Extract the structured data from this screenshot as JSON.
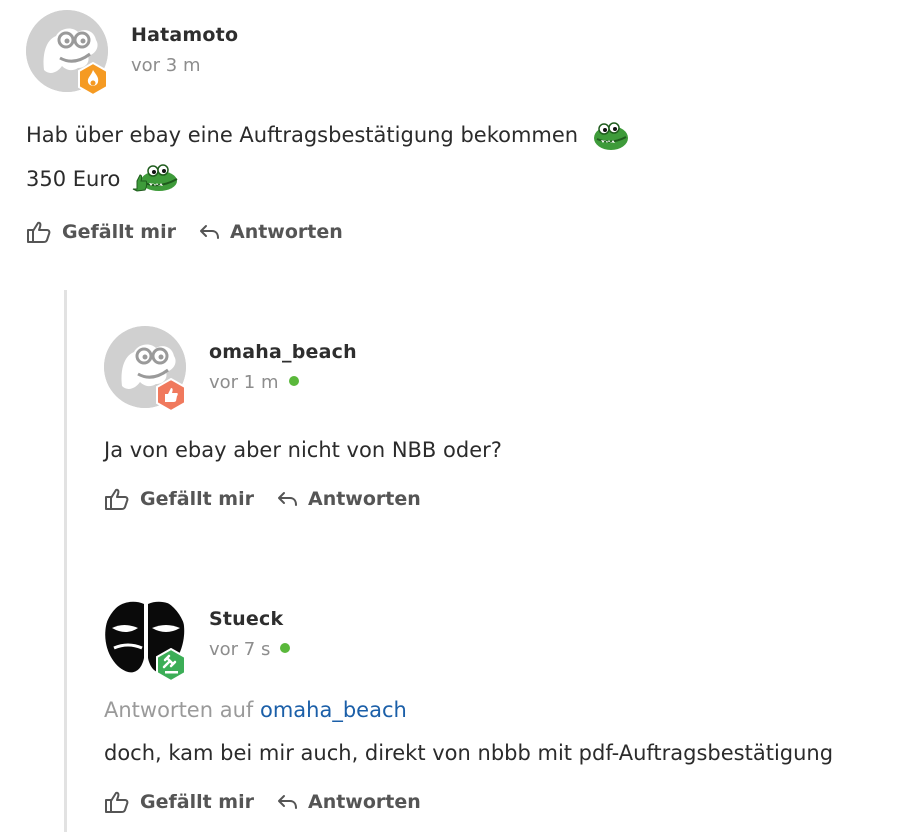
{
  "comments": [
    {
      "username": "Hatamoto",
      "time": "vor 3 m",
      "online": false,
      "avatar_icon": "dino-avatar-icon",
      "badge_icon": "flame-badge-icon",
      "badge_color": "#f59a22",
      "lines": [
        "Hab über ebay eine Auftragsbestätigung bekommen",
        "350 Euro"
      ],
      "like_label": "Gefällt mir",
      "reply_label": "Antworten"
    },
    {
      "username": "omaha_beach",
      "time": "vor 1 m",
      "online": true,
      "avatar_icon": "dino-avatar-icon",
      "badge_icon": "thumb-badge-icon",
      "badge_color": "#f0795d",
      "lines": [
        "Ja von ebay aber nicht von NBB oder?"
      ],
      "like_label": "Gefällt mir",
      "reply_label": "Antworten"
    },
    {
      "username": "Stueck",
      "time": "vor 7 s",
      "online": true,
      "avatar_icon": "mask-avatar-icon",
      "badge_icon": "gavel-badge-icon",
      "badge_color": "#3cae57",
      "reply_to_prefix": "Antworten auf",
      "reply_to_user": "omaha_beach",
      "lines": [
        "doch, kam bei mir auch, direkt von nbbb mit pdf-Auftragsbestätigung"
      ],
      "like_label": "Gefällt mir",
      "reply_label": "Antworten"
    }
  ],
  "colors": {
    "online": "#5ab83b",
    "link": "#1b5fa8",
    "thread_line": "#e2e2e2"
  }
}
